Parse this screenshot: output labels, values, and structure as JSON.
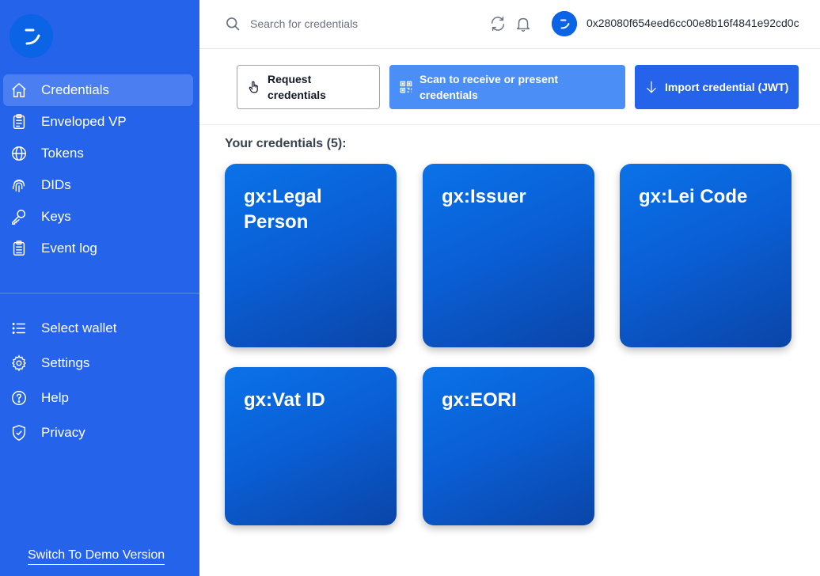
{
  "sidebar": {
    "logo": "walt-logo",
    "items": [
      {
        "label": "Credentials",
        "icon": "home-icon",
        "active": true
      },
      {
        "label": "Enveloped VP",
        "icon": "clipboard-icon",
        "active": false
      },
      {
        "label": "Tokens",
        "icon": "globe-icon",
        "active": false
      },
      {
        "label": "DIDs",
        "icon": "fingerprint-icon",
        "active": false
      },
      {
        "label": "Keys",
        "icon": "key-icon",
        "active": false
      },
      {
        "label": "Event log",
        "icon": "clipboard-list-icon",
        "active": false
      }
    ],
    "secondary_items": [
      {
        "label": "Select wallet",
        "icon": "list-icon"
      },
      {
        "label": "Settings",
        "icon": "gear-icon"
      },
      {
        "label": "Help",
        "icon": "question-circle-icon"
      },
      {
        "label": "Privacy",
        "icon": "shield-check-icon"
      }
    ],
    "switch_label": "Switch To Demo Version",
    "bg_color": "#2563eb",
    "active_color": "#4b7ef0"
  },
  "header": {
    "search_placeholder": "Search for credentials",
    "address": "0x28080f654eed6cc00e8b16f4841e92cd0c"
  },
  "actions": {
    "request_label": "Request credentials",
    "scan_label": "Scan to receive or present credentials",
    "import_label": "Import credential (JWT)"
  },
  "content": {
    "count_label": "Your credentials (5):",
    "credentials": [
      {
        "title": "gx:Legal Person"
      },
      {
        "title": "gx:Issuer"
      },
      {
        "title": "gx:Lei Code"
      },
      {
        "title": "gx:Vat ID"
      },
      {
        "title": "gx:EORI"
      }
    ]
  }
}
